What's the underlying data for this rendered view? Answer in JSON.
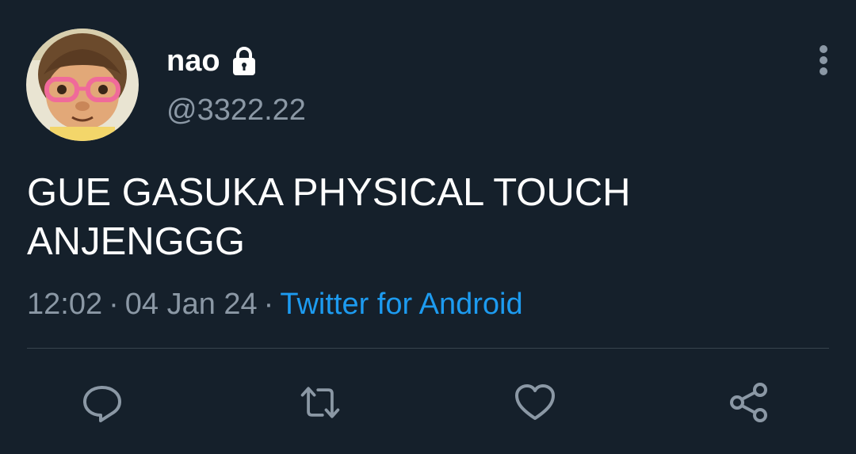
{
  "user": {
    "display_name": "nao",
    "handle": "@3322.22",
    "protected_icon": "lock-icon",
    "avatar": "avatar"
  },
  "tweet": {
    "text": "GUE GASUKA PHYSICAL TOUCH ANJENGGG",
    "time": "12:02",
    "date": "04 Jan 24",
    "source": "Twitter for Android",
    "separator": "·"
  },
  "actions": [
    {
      "name": "reply",
      "icon": "reply-icon"
    },
    {
      "name": "retweet",
      "icon": "retweet-icon"
    },
    {
      "name": "like",
      "icon": "heart-icon"
    },
    {
      "name": "share",
      "icon": "share-icon"
    }
  ],
  "menu": {
    "icon": "more-vertical-icon"
  },
  "colors": {
    "background": "#15202b",
    "primary_text": "#ffffff",
    "secondary_text": "#8b98a5",
    "link": "#1d9bf0",
    "divider": "#38444d"
  }
}
